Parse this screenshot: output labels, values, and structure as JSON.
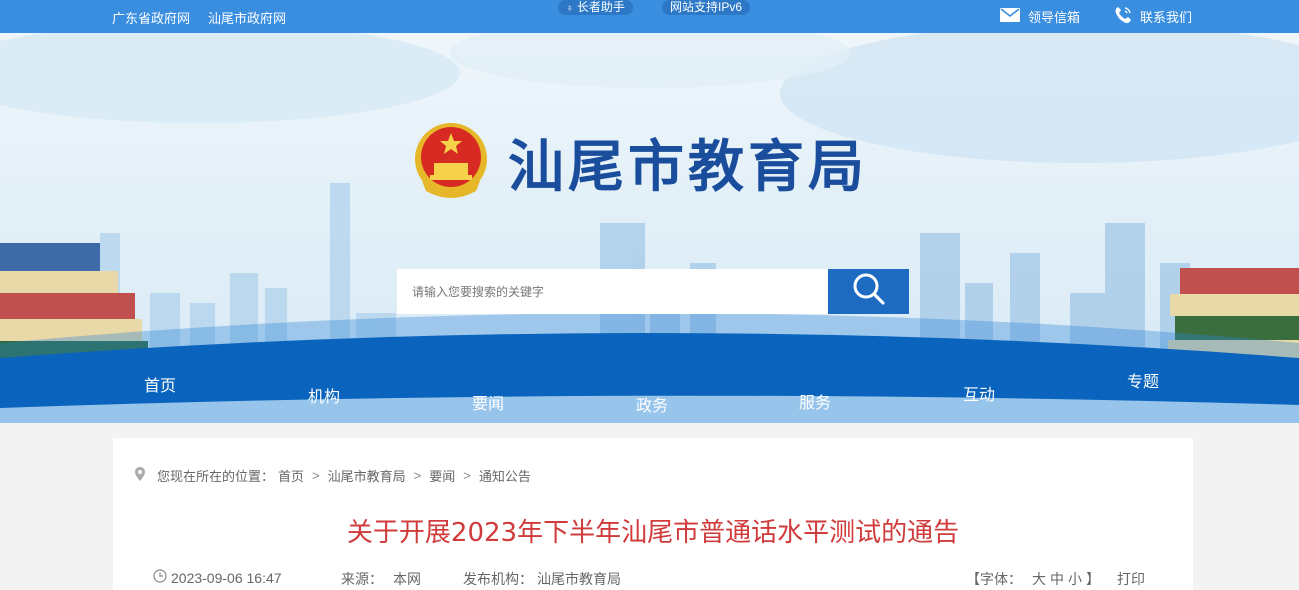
{
  "topbar": {
    "links": [
      "广东省政府网",
      "汕尾市政府网"
    ],
    "elder_helper": "长者助手",
    "ipv6": "网站支持IPv6",
    "mailbox": "领导信箱",
    "contact": "联系我们"
  },
  "header": {
    "title": "汕尾市教育局"
  },
  "search": {
    "placeholder": "请输入您要搜索的关键字"
  },
  "nav": [
    "首页",
    "机构",
    "要闻",
    "政务",
    "服务",
    "互动",
    "专题"
  ],
  "breadcrumb": {
    "prefix": "您现在所在的位置：",
    "items": [
      "首页",
      "汕尾市教育局",
      "要闻",
      "通知公告"
    ],
    "separator": ">"
  },
  "article": {
    "title": "关于开展2023年下半年汕尾市普通话水平测试的通告",
    "date": "2023-09-06 16:47",
    "source_label": "来源：",
    "source": "本网",
    "publisher_label": "发布机构：",
    "publisher": "汕尾市教育局",
    "font_label": "【字体：",
    "font_large": "大",
    "font_medium": "中",
    "font_small": "小",
    "font_close": "】",
    "print": "打印"
  },
  "colors": {
    "topbar": "#3a8ee0",
    "nav_band": "#0a64bd",
    "title_blue": "#1a4d9c",
    "article_title_red": "#d03b3b",
    "search_button": "#1d6cc2"
  }
}
